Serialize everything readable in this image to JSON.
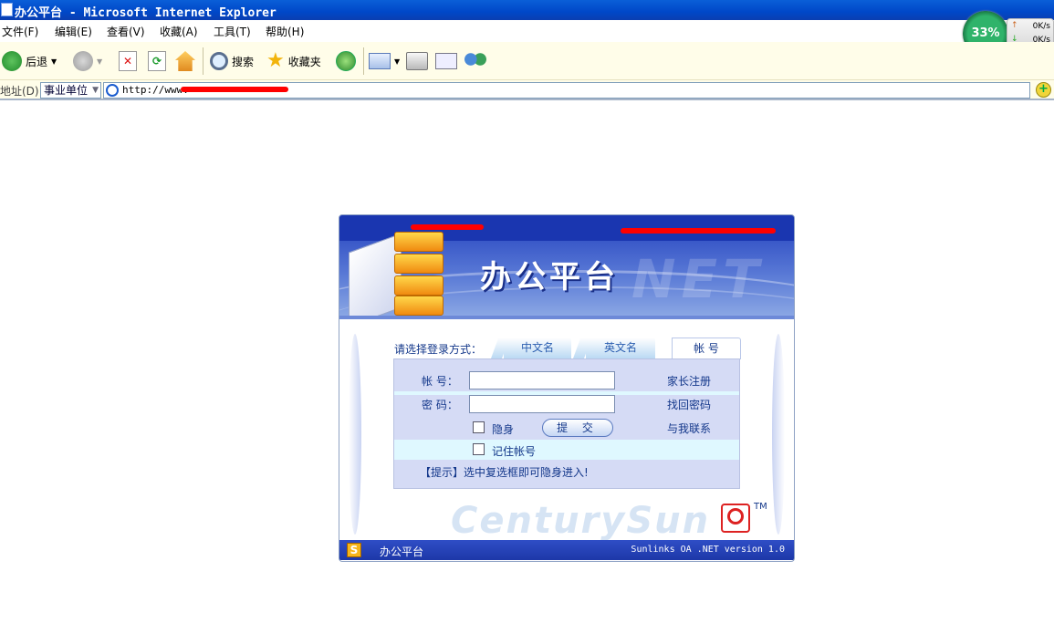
{
  "window": {
    "title": "办公平台 - Microsoft Internet Explorer"
  },
  "menu": [
    "文件(F)",
    "编辑(E)",
    "查看(V)",
    "收藏(A)",
    "工具(T)",
    "帮助(H)"
  ],
  "toolbar": {
    "back": "后退",
    "search": "搜索",
    "favorites": "收藏夹"
  },
  "address": {
    "label": "地址(D)",
    "dropdown": "事业单位",
    "url": "http://www."
  },
  "netmon": {
    "percent": "33%",
    "up": "0K/s",
    "down": "0K/s"
  },
  "login": {
    "title": "办公平台",
    "choose_label": "请选择登录方式：",
    "tabs": [
      "中文名",
      "英文名",
      "帐  号"
    ],
    "account_label": "帐  号：",
    "password_label": "密  码：",
    "links": [
      "家长注册",
      "找回密码",
      "与我联系"
    ],
    "invisible": "隐身",
    "submit": "提 交",
    "remember": "记住帐号",
    "hint": "【提示】选中复选框即可隐身进入!",
    "watermark": "CenturySun",
    "tm": "TM",
    "footer_name": "办公平台",
    "footer_version": "Sunlinks OA .NET version 1.0",
    "bg_net": "NET"
  }
}
